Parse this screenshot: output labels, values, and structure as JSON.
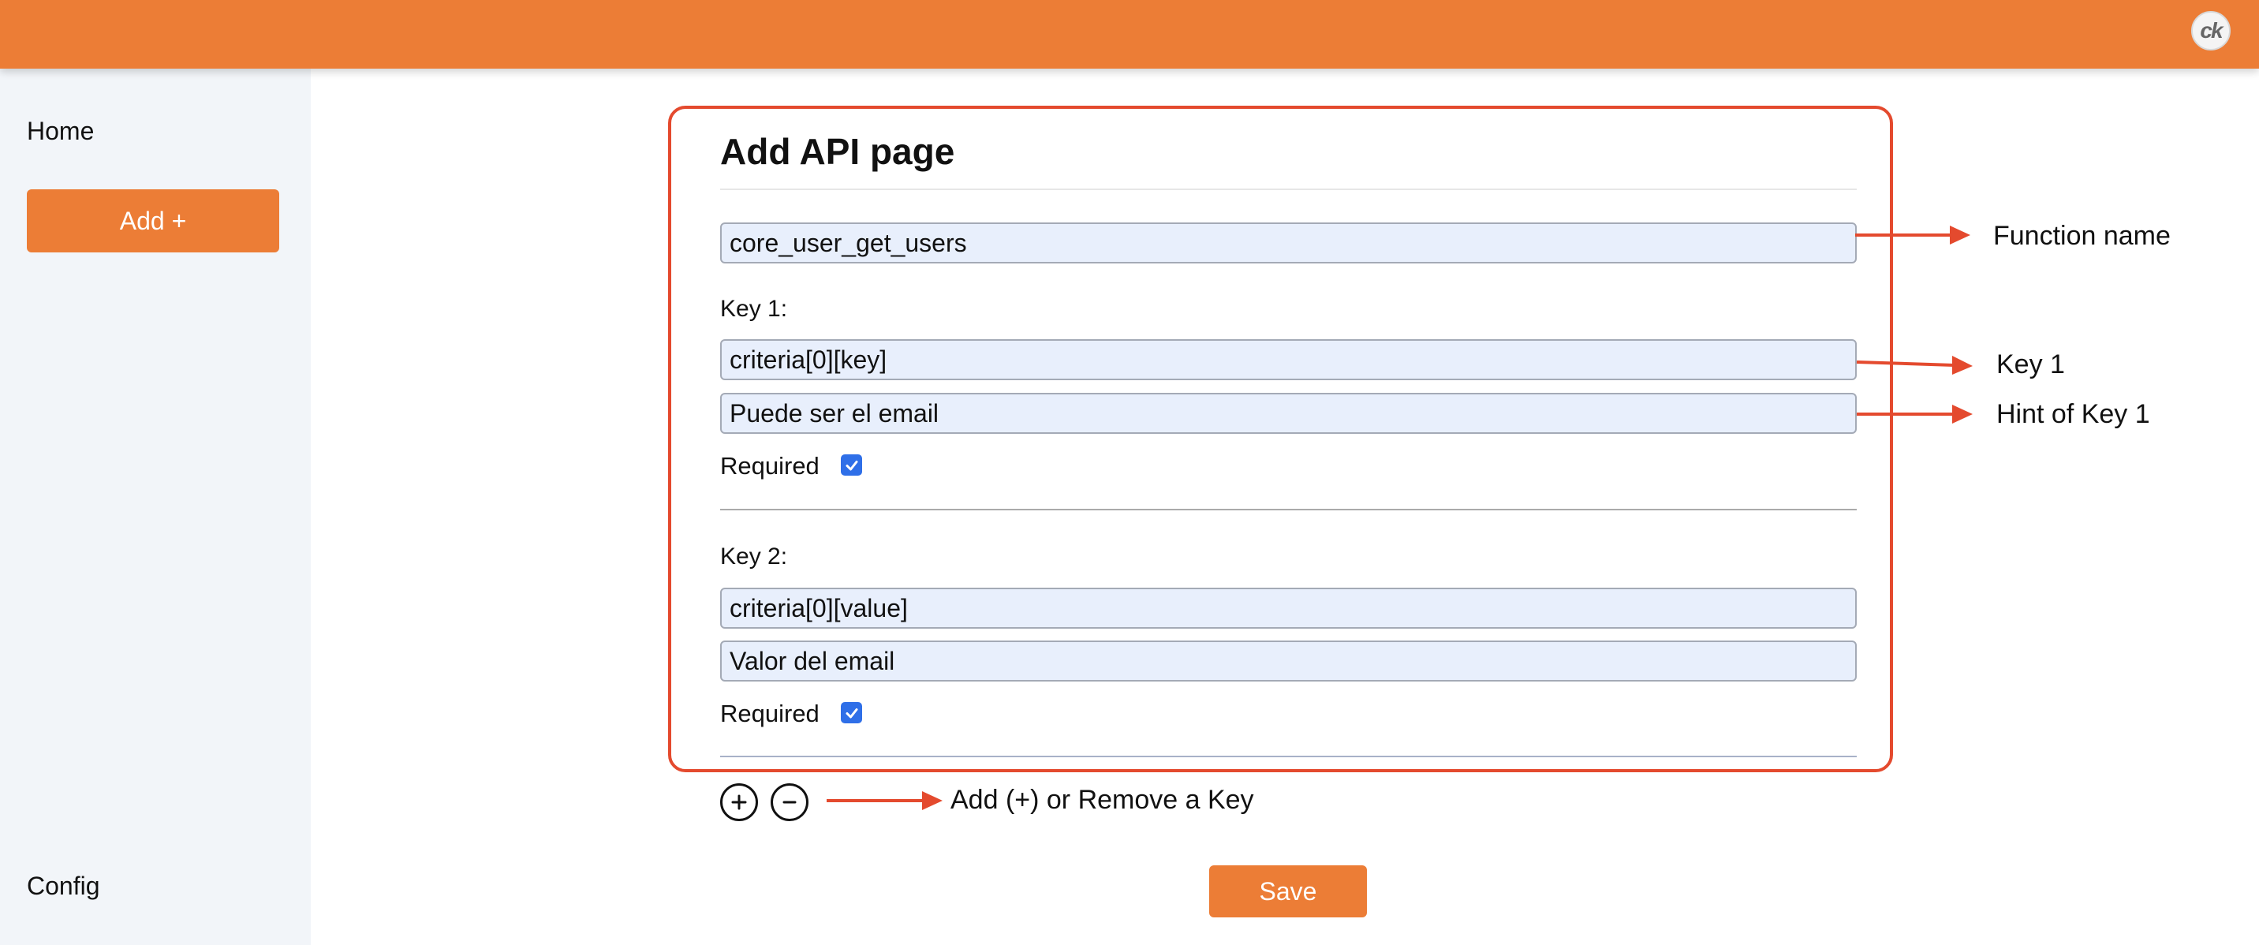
{
  "header": {
    "avatar_text": "ck",
    "accent_color": "#ec7d36"
  },
  "sidebar": {
    "home_label": "Home",
    "add_label": "Add +",
    "config_label": "Config"
  },
  "form": {
    "title": "Add API page",
    "function_name_value": "core_user_get_users",
    "keys": [
      {
        "label": "Key 1:",
        "key_value": "criteria[0][key]",
        "hint_value": "Puede ser el email",
        "required_label": "Required",
        "required": true
      },
      {
        "label": "Key 2:",
        "key_value": "criteria[0][value]",
        "hint_value": "Valor del email",
        "required_label": "Required",
        "required": true
      }
    ],
    "add_key_icon": "plus-circle-icon",
    "remove_key_icon": "minus-circle-icon",
    "save_label": "Save"
  },
  "annotations": {
    "function_name": "Function name",
    "key_1": "Key 1",
    "hint_key_1": "Hint of Key 1",
    "add_remove": "Add (+) or Remove a Key",
    "highlight_color": "#e44a2e"
  }
}
